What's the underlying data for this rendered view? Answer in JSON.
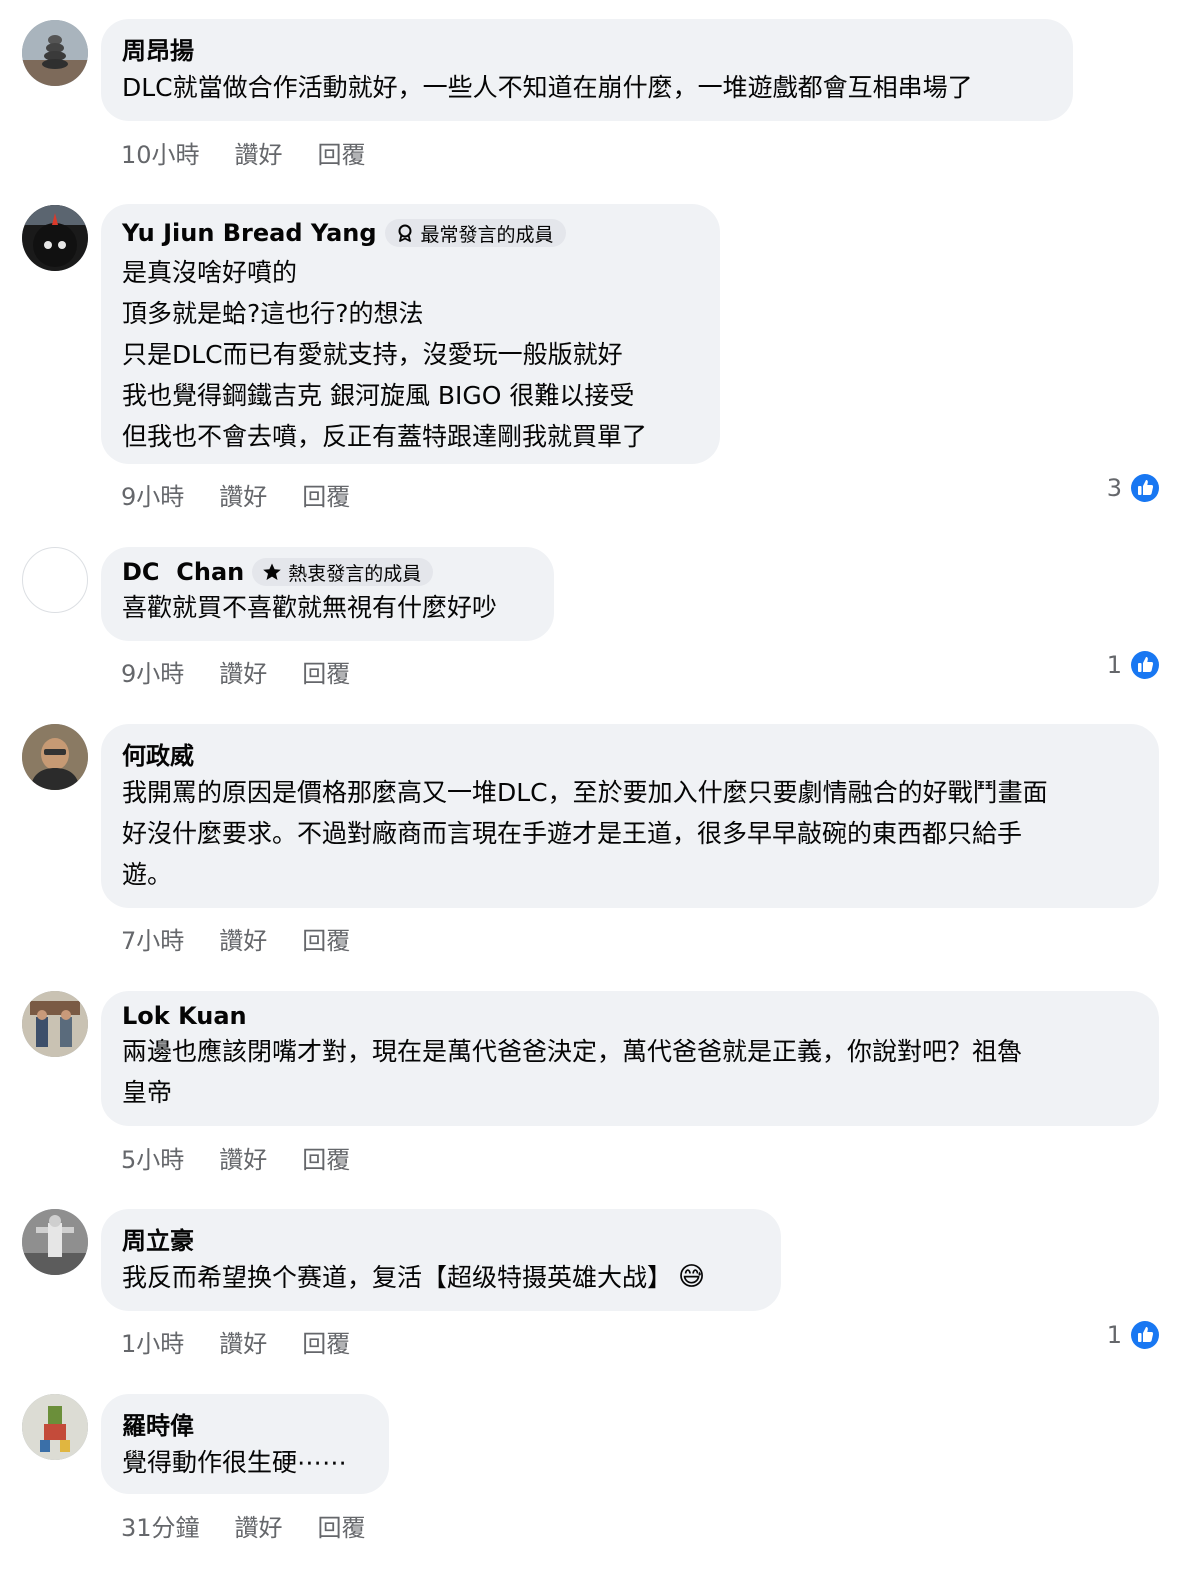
{
  "actions": {
    "like": "讚好",
    "reply": "回覆"
  },
  "comments": [
    {
      "name": "周昂揚",
      "badge": null,
      "lines": [
        "DLC就當做合作活動就好，一些人不知道在崩什麼，一堆遊戲都會互相串場了"
      ],
      "time": "10小時",
      "reactions": null
    },
    {
      "name": "Yu Jiun Bread Yang",
      "badge": "最常發言的成員",
      "lines": [
        "是真沒啥好噴的",
        "頂多就是蛤?這也行?的想法",
        "只是DLC而已有愛就支持，沒愛玩一般版就好",
        "我也覺得鋼鐵吉克 銀河旋風 BIGO 很難以接受",
        "但我也不會去噴，反正有蓋特跟達剛我就買單了"
      ],
      "time": "9小時",
      "reactions": "3"
    },
    {
      "name": "DC  Chan",
      "badge": "熱衷發言的成員",
      "lines": [
        "喜歡就買不喜歡就無視有什麼好吵"
      ],
      "time": "9小時",
      "reactions": "1"
    },
    {
      "name": "何政威",
      "badge": null,
      "lines": [
        "我開罵的原因是價格那麼高又一堆DLC，至於要加入什麼只要劇情融合的好戰鬥畫面",
        "好沒什麼要求。不過對廠商而言現在手遊才是王道，很多早早敲碗的東西都只給手",
        "遊。"
      ],
      "time": "7小時",
      "reactions": null
    },
    {
      "name": "Lok Kuan",
      "badge": null,
      "lines": [
        "兩邊也應該閉嘴才對，現在是萬代爸爸決定，萬代爸爸就是正義，你說對吧？祖魯",
        "皇帝"
      ],
      "time": "5小時",
      "reactions": null
    },
    {
      "name": "周立豪",
      "badge": null,
      "lines": [
        "我反而希望换个赛道，复活【超级特摄英雄大战】"
      ],
      "emoji": "😅",
      "time": "1小時",
      "reactions": "1"
    },
    {
      "name": "羅時偉",
      "badge": null,
      "lines": [
        "覺得動作很生硬⋯⋯"
      ],
      "time": "31分鐘",
      "reactions": null
    }
  ],
  "colors": {
    "like_blue": "#1877f2",
    "bubble_bg": "#f0f2f5",
    "meta_gray": "#65676b"
  }
}
